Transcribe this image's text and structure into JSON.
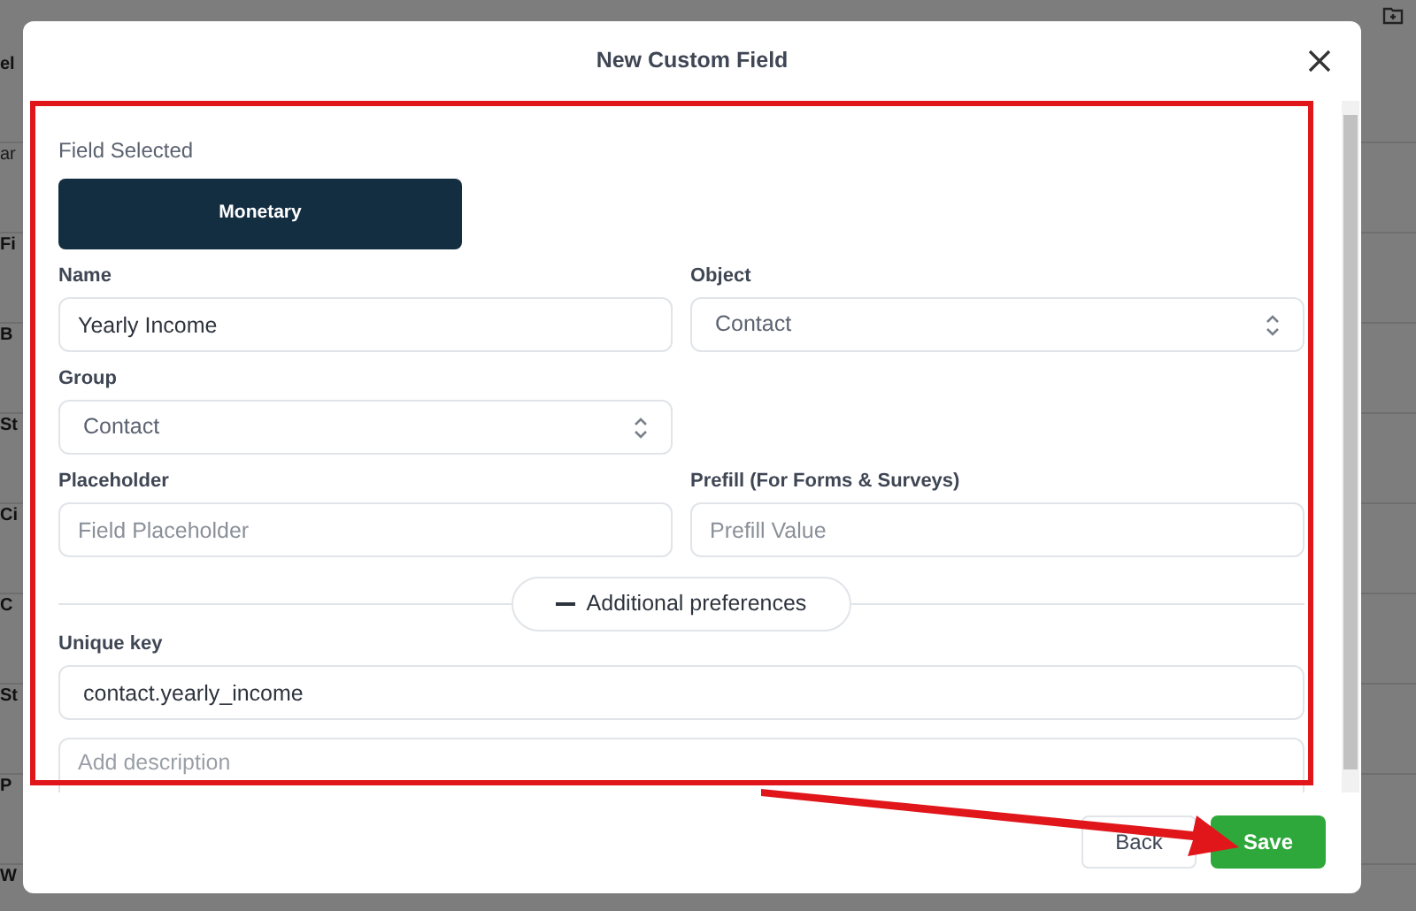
{
  "background": {
    "row_labels": [
      "el",
      "ar",
      "Fi",
      "B",
      "St",
      "Ci",
      "C",
      "St",
      "P",
      "W"
    ]
  },
  "modal": {
    "title": "New Custom Field",
    "section_label": "Field Selected",
    "field_type": "Monetary",
    "rows": [
      [
        {
          "label": "Name",
          "kind": "text",
          "value": "Yearly Income"
        },
        {
          "label": "Object",
          "kind": "select",
          "value": "Contact"
        }
      ],
      [
        {
          "label": "Group",
          "kind": "select",
          "value": "Contact"
        }
      ],
      [
        {
          "label": "Placeholder",
          "kind": "text",
          "placeholder": "Field Placeholder"
        },
        {
          "label": "Prefill (For Forms & Surveys)",
          "kind": "text",
          "placeholder": "Prefill Value"
        }
      ]
    ],
    "preferences": {
      "label": "Additional preferences",
      "expanded": true
    },
    "unique_key": {
      "label": "Unique key",
      "value": "contact.yearly_income"
    },
    "description": {
      "placeholder": "Add description"
    },
    "buttons": [
      {
        "label": "Back",
        "kind": "secondary"
      },
      {
        "label": "Save",
        "kind": "primary"
      }
    ]
  }
}
